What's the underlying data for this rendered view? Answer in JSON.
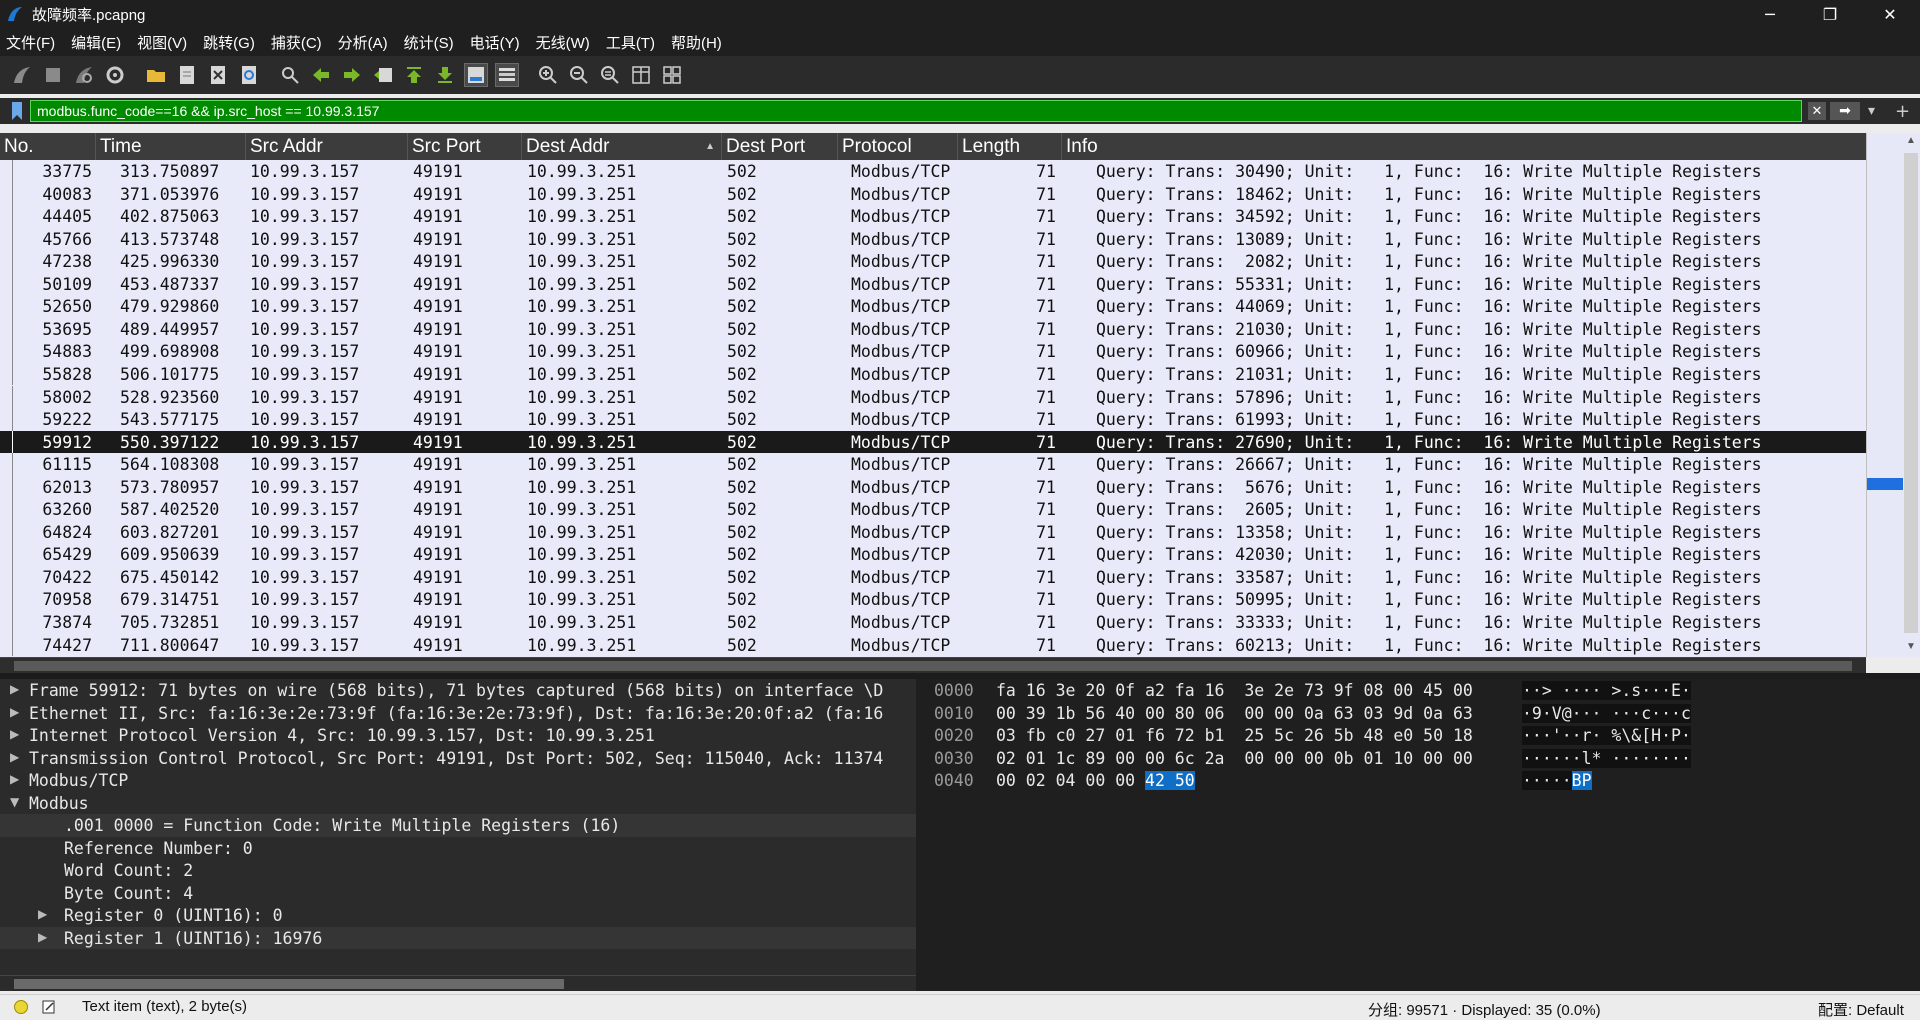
{
  "window": {
    "title": "故障频率.pcapng",
    "minimize": "─",
    "maximize": "❐",
    "close": "✕"
  },
  "menu": [
    "文件(F)",
    "编辑(E)",
    "视图(V)",
    "跳转(G)",
    "捕获(C)",
    "分析(A)",
    "统计(S)",
    "电话(Y)",
    "无线(W)",
    "工具(T)",
    "帮助(H)"
  ],
  "filter": {
    "value": "modbus.func_code==16 && ip.src_host == 10.99.3.157",
    "clear_icon": "✕",
    "apply_icon": "➡",
    "dropdown_icon": "▾",
    "add_icon": "+"
  },
  "columns": [
    "No.",
    "Time",
    "Src Addr",
    "Src Port",
    "Dest Addr",
    "Dest Port",
    "Protocol",
    "Length",
    "Info"
  ],
  "sort_indicator": "▲",
  "packets": [
    {
      "no": "33775",
      "time": "313.750897",
      "src": "10.99.3.157",
      "sport": "49191",
      "dst": "10.99.3.251",
      "dport": "502",
      "proto": "Modbus/TCP",
      "len": "71",
      "info": "Query: Trans: 30490; Unit:   1, Func:  16: Write Multiple Registers"
    },
    {
      "no": "40083",
      "time": "371.053976",
      "src": "10.99.3.157",
      "sport": "49191",
      "dst": "10.99.3.251",
      "dport": "502",
      "proto": "Modbus/TCP",
      "len": "71",
      "info": "Query: Trans: 18462; Unit:   1, Func:  16: Write Multiple Registers"
    },
    {
      "no": "44405",
      "time": "402.875063",
      "src": "10.99.3.157",
      "sport": "49191",
      "dst": "10.99.3.251",
      "dport": "502",
      "proto": "Modbus/TCP",
      "len": "71",
      "info": "Query: Trans: 34592; Unit:   1, Func:  16: Write Multiple Registers"
    },
    {
      "no": "45766",
      "time": "413.573748",
      "src": "10.99.3.157",
      "sport": "49191",
      "dst": "10.99.3.251",
      "dport": "502",
      "proto": "Modbus/TCP",
      "len": "71",
      "info": "Query: Trans: 13089; Unit:   1, Func:  16: Write Multiple Registers"
    },
    {
      "no": "47238",
      "time": "425.996330",
      "src": "10.99.3.157",
      "sport": "49191",
      "dst": "10.99.3.251",
      "dport": "502",
      "proto": "Modbus/TCP",
      "len": "71",
      "info": "Query: Trans:  2082; Unit:   1, Func:  16: Write Multiple Registers"
    },
    {
      "no": "50109",
      "time": "453.487337",
      "src": "10.99.3.157",
      "sport": "49191",
      "dst": "10.99.3.251",
      "dport": "502",
      "proto": "Modbus/TCP",
      "len": "71",
      "info": "Query: Trans: 55331; Unit:   1, Func:  16: Write Multiple Registers"
    },
    {
      "no": "52650",
      "time": "479.929860",
      "src": "10.99.3.157",
      "sport": "49191",
      "dst": "10.99.3.251",
      "dport": "502",
      "proto": "Modbus/TCP",
      "len": "71",
      "info": "Query: Trans: 44069; Unit:   1, Func:  16: Write Multiple Registers"
    },
    {
      "no": "53695",
      "time": "489.449957",
      "src": "10.99.3.157",
      "sport": "49191",
      "dst": "10.99.3.251",
      "dport": "502",
      "proto": "Modbus/TCP",
      "len": "71",
      "info": "Query: Trans: 21030; Unit:   1, Func:  16: Write Multiple Registers"
    },
    {
      "no": "54883",
      "time": "499.698908",
      "src": "10.99.3.157",
      "sport": "49191",
      "dst": "10.99.3.251",
      "dport": "502",
      "proto": "Modbus/TCP",
      "len": "71",
      "info": "Query: Trans: 60966; Unit:   1, Func:  16: Write Multiple Registers"
    },
    {
      "no": "55828",
      "time": "506.101775",
      "src": "10.99.3.157",
      "sport": "49191",
      "dst": "10.99.3.251",
      "dport": "502",
      "proto": "Modbus/TCP",
      "len": "71",
      "info": "Query: Trans: 21031; Unit:   1, Func:  16: Write Multiple Registers"
    },
    {
      "no": "58002",
      "time": "528.923560",
      "src": "10.99.3.157",
      "sport": "49191",
      "dst": "10.99.3.251",
      "dport": "502",
      "proto": "Modbus/TCP",
      "len": "71",
      "info": "Query: Trans: 57896; Unit:   1, Func:  16: Write Multiple Registers"
    },
    {
      "no": "59222",
      "time": "543.577175",
      "src": "10.99.3.157",
      "sport": "49191",
      "dst": "10.99.3.251",
      "dport": "502",
      "proto": "Modbus/TCP",
      "len": "71",
      "info": "Query: Trans: 61993; Unit:   1, Func:  16: Write Multiple Registers"
    },
    {
      "no": "59912",
      "time": "550.397122",
      "src": "10.99.3.157",
      "sport": "49191",
      "dst": "10.99.3.251",
      "dport": "502",
      "proto": "Modbus/TCP",
      "len": "71",
      "info": "Query: Trans: 27690; Unit:   1, Func:  16: Write Multiple Registers",
      "selected": true
    },
    {
      "no": "61115",
      "time": "564.108308",
      "src": "10.99.3.157",
      "sport": "49191",
      "dst": "10.99.3.251",
      "dport": "502",
      "proto": "Modbus/TCP",
      "len": "71",
      "info": "Query: Trans: 26667; Unit:   1, Func:  16: Write Multiple Registers"
    },
    {
      "no": "62013",
      "time": "573.780957",
      "src": "10.99.3.157",
      "sport": "49191",
      "dst": "10.99.3.251",
      "dport": "502",
      "proto": "Modbus/TCP",
      "len": "71",
      "info": "Query: Trans:  5676; Unit:   1, Func:  16: Write Multiple Registers"
    },
    {
      "no": "63260",
      "time": "587.402520",
      "src": "10.99.3.157",
      "sport": "49191",
      "dst": "10.99.3.251",
      "dport": "502",
      "proto": "Modbus/TCP",
      "len": "71",
      "info": "Query: Trans:  2605; Unit:   1, Func:  16: Write Multiple Registers"
    },
    {
      "no": "64824",
      "time": "603.827201",
      "src": "10.99.3.157",
      "sport": "49191",
      "dst": "10.99.3.251",
      "dport": "502",
      "proto": "Modbus/TCP",
      "len": "71",
      "info": "Query: Trans: 13358; Unit:   1, Func:  16: Write Multiple Registers"
    },
    {
      "no": "65429",
      "time": "609.950639",
      "src": "10.99.3.157",
      "sport": "49191",
      "dst": "10.99.3.251",
      "dport": "502",
      "proto": "Modbus/TCP",
      "len": "71",
      "info": "Query: Trans: 42030; Unit:   1, Func:  16: Write Multiple Registers"
    },
    {
      "no": "70422",
      "time": "675.450142",
      "src": "10.99.3.157",
      "sport": "49191",
      "dst": "10.99.3.251",
      "dport": "502",
      "proto": "Modbus/TCP",
      "len": "71",
      "info": "Query: Trans: 33587; Unit:   1, Func:  16: Write Multiple Registers"
    },
    {
      "no": "70958",
      "time": "679.314751",
      "src": "10.99.3.157",
      "sport": "49191",
      "dst": "10.99.3.251",
      "dport": "502",
      "proto": "Modbus/TCP",
      "len": "71",
      "info": "Query: Trans: 50995; Unit:   1, Func:  16: Write Multiple Registers"
    },
    {
      "no": "73874",
      "time": "705.732851",
      "src": "10.99.3.157",
      "sport": "49191",
      "dst": "10.99.3.251",
      "dport": "502",
      "proto": "Modbus/TCP",
      "len": "71",
      "info": "Query: Trans: 33333; Unit:   1, Func:  16: Write Multiple Registers"
    },
    {
      "no": "74427",
      "time": "711.800647",
      "src": "10.99.3.157",
      "sport": "49191",
      "dst": "10.99.3.251",
      "dport": "502",
      "proto": "Modbus/TCP",
      "len": "71",
      "info": "Query: Trans: 60213; Unit:   1, Func:  16: Write Multiple Registers"
    }
  ],
  "details": [
    {
      "indent": 0,
      "arrow": "▶",
      "text": "Frame 59912: 71 bytes on wire (568 bits), 71 bytes captured (568 bits) on interface \\D"
    },
    {
      "indent": 0,
      "arrow": "▶",
      "text": "Ethernet II, Src: fa:16:3e:2e:73:9f (fa:16:3e:2e:73:9f), Dst: fa:16:3e:20:0f:a2 (fa:16"
    },
    {
      "indent": 0,
      "arrow": "▶",
      "text": "Internet Protocol Version 4, Src: 10.99.3.157, Dst: 10.99.3.251"
    },
    {
      "indent": 0,
      "arrow": "▶",
      "text": "Transmission Control Protocol, Src Port: 49191, Dst Port: 502, Seq: 115040, Ack: 11374"
    },
    {
      "indent": 0,
      "arrow": "▶",
      "text": "Modbus/TCP"
    },
    {
      "indent": 0,
      "arrow": "▼",
      "text": "Modbus"
    },
    {
      "indent": 1,
      "arrow": "",
      "text": ".001 0000 = Function Code: Write Multiple Registers (16)",
      "hl": true
    },
    {
      "indent": 1,
      "arrow": "",
      "text": "Reference Number: 0"
    },
    {
      "indent": 1,
      "arrow": "",
      "text": "Word Count: 2"
    },
    {
      "indent": 1,
      "arrow": "",
      "text": "Byte Count: 4"
    },
    {
      "indent": 1,
      "arrow": "▶",
      "text": "Register 0 (UINT16): 0"
    },
    {
      "indent": 1,
      "arrow": "▶",
      "text": "Register 1 (UINT16): 16976",
      "hl": true
    }
  ],
  "bytes": [
    {
      "offset": "0000",
      "hex": "fa 16 3e 20 0f a2 fa 16  3e 2e 73 9f 08 00 45 00",
      "ascii": "··> ···· >.s···E·"
    },
    {
      "offset": "0010",
      "hex": "00 39 1b 56 40 00 80 06  00 00 0a 63 03 9d 0a 63",
      "ascii": "·9·V@··· ···c···c"
    },
    {
      "offset": "0020",
      "hex": "03 fb c0 27 01 f6 72 b1  25 5c 26 5b 48 e0 50 18",
      "ascii": "···'··r· %\\&[H·P·"
    },
    {
      "offset": "0030",
      "hex": "02 01 1c 89 00 00 6c 2a  00 00 00 0b 01 10 00 00",
      "ascii": "······l* ········"
    },
    {
      "offset": "0040",
      "hex": "00 02 04 00 00 ",
      "hex_sel": "42 50",
      "ascii": "·····",
      "ascii_sel": "BP"
    }
  ],
  "status": {
    "text": "Text item (text), 2 byte(s)",
    "packets": "分组: 99571 · Displayed: 35 (0.0%)",
    "profile": "配置: Default"
  }
}
